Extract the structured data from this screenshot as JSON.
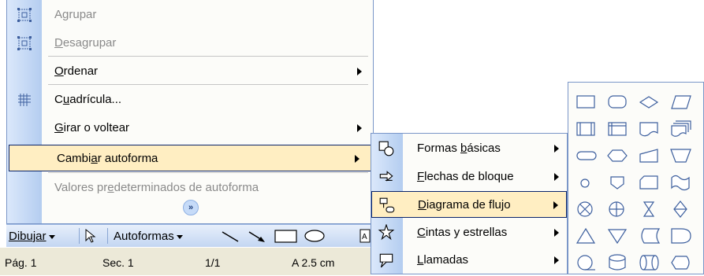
{
  "main_menu": {
    "items": [
      {
        "label": "Agrupar",
        "hotkey_index": 1,
        "disabled": true,
        "icon": "group-icon"
      },
      {
        "label": "Desagrupar",
        "hotkey_index": 0,
        "disabled": true,
        "icon": "ungroup-icon"
      },
      {
        "label": "Ordenar",
        "hotkey_index": 0,
        "submenu": true
      },
      {
        "label": "Cuadrícula...",
        "hotkey_index": 1,
        "icon": "grid-icon"
      },
      {
        "label": "Girar o voltear",
        "hotkey_index": 0,
        "submenu": true
      },
      {
        "label": "Cambiar autoforma",
        "hotkey_index": 5,
        "submenu": true,
        "highlighted": true
      },
      {
        "label": "Valores predeterminados de autoforma",
        "hotkey_index": 10,
        "disabled": true
      }
    ],
    "expand_glyph": "»"
  },
  "draw_toolbar": {
    "dibujar_label": "Dibujar",
    "autoformas_label": "Autoformas"
  },
  "status_bar": {
    "page": "Pág. 1",
    "section": "Sec. 1",
    "count": "1/1",
    "position": "A 2.5 cm"
  },
  "submenu": {
    "items": [
      {
        "label": "Formas básicas",
        "icon": "basic-shapes-icon"
      },
      {
        "label": "Flechas de bloque",
        "icon": "block-arrows-icon"
      },
      {
        "label": "Diagrama de flujo",
        "icon": "flowchart-icon",
        "highlighted": true
      },
      {
        "label": "Cintas y estrellas",
        "icon": "stars-banners-icon"
      },
      {
        "label": "Llamadas",
        "icon": "callouts-icon"
      }
    ]
  },
  "palette": {
    "icon_color": "#3d5f9e",
    "shapes": [
      "process",
      "alternate-process",
      "decision",
      "data",
      "predefined-process",
      "internal-storage",
      "document",
      "multidocument",
      "terminator",
      "preparation",
      "manual-input",
      "manual-operation",
      "connector",
      "offpage-connector",
      "card",
      "punched-tape",
      "summing-junction",
      "or",
      "collate",
      "sort",
      "extract",
      "merge",
      "stored-data",
      "delay",
      "sequential-access",
      "magnetic-disk",
      "direct-access",
      "display"
    ]
  },
  "colors": {
    "menu_border": "#7a96c8",
    "highlight_bg": "#ffeec2",
    "highlight_border": "#0a246a",
    "disabled_text": "#8a8a8a"
  }
}
